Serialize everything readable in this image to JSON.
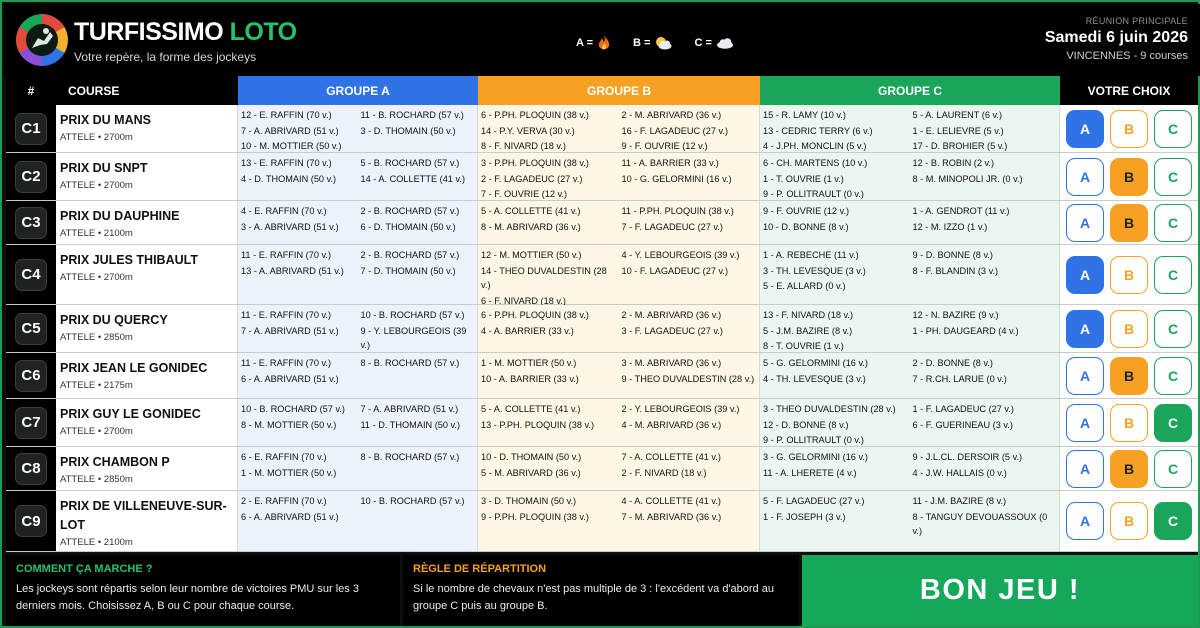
{
  "header": {
    "brand_main": "TURFISSIMO",
    "brand_accent": "LOTO",
    "tagline": "Votre repère, la forme des jockeys",
    "legend": [
      {
        "label": "A =",
        "icon": "flame-icon"
      },
      {
        "label": "B =",
        "icon": "sun-cloud-icon"
      },
      {
        "label": "C =",
        "icon": "cloud-icon"
      }
    ],
    "meeting_label": "RÉUNION PRINCIPALE",
    "meeting_date": "Samedi 6 juin 2026",
    "meeting_venue": "VINCENNES - 9 courses"
  },
  "columns": {
    "num": "#",
    "course": "COURSE",
    "group_a": "GROUPE A",
    "group_b": "GROUPE B",
    "group_c": "GROUPE C",
    "choice": "VOTRE CHOIX"
  },
  "races": [
    {
      "id": "C1",
      "name": "PRIX DU MANS",
      "info": "ATTELE • 2700m",
      "selected": "A",
      "a": [
        "12 - E. RAFFIN (70 v.)",
        "11 - B. ROCHARD (57 v.)",
        "7 - A. ABRIVARD (51 v.)",
        "3 - D. THOMAIN (50 v.)",
        "10 - M. MOTTIER (50 v.)"
      ],
      "b": [
        "6 - P.PH. PLOQUIN (38 v.)",
        "2 - M. ABRIVARD (36 v.)",
        "14 - P.Y. VERVA (30 v.)",
        "16 - F. LAGADEUC (27 v.)",
        "8 - F. NIVARD (18 v.)",
        "9 - F. OUVRIE (12 v.)"
      ],
      "c": [
        "15 - R. LAMY (10 v.)",
        "5 - A. LAURENT (6 v.)",
        "13 - CEDRIC TERRY (6 v.)",
        "1 - E. LELIEVRE (5 v.)",
        "4 - J.PH. MONCLIN (5 v.)",
        "17 - D. BROHIER (5 v.)"
      ]
    },
    {
      "id": "C2",
      "name": "PRIX DU SNPT",
      "info": "ATTELE • 2700m",
      "selected": "B",
      "a": [
        "13 - E. RAFFIN (70 v.)",
        "5 - B. ROCHARD (57 v.)",
        "4 - D. THOMAIN (50 v.)",
        "14 - A. COLLETTE (41 v.)"
      ],
      "b": [
        "3 - P.PH. PLOQUIN (38 v.)",
        "11 - A. BARRIER (33 v.)",
        "2 - F. LAGADEUC (27 v.)",
        "10 - G. GELORMINI (16 v.)",
        "7 - F. OUVRIE (12 v.)"
      ],
      "c": [
        "6 - CH. MARTENS (10 v.)",
        "12 - B. ROBIN (2 v.)",
        "1 - T. OUVRIE (1 v.)",
        "8 - M. MINOPOLI JR. (0 v.)",
        "9 - P. OLLITRAULT (0 v.)"
      ]
    },
    {
      "id": "C3",
      "name": "PRIX DU DAUPHINE",
      "info": "ATTELE • 2100m",
      "selected": "B",
      "a": [
        "4 - E. RAFFIN (70 v.)",
        "2 - B. ROCHARD (57 v.)",
        "3 - A. ABRIVARD (51 v.)",
        "6 - D. THOMAIN (50 v.)"
      ],
      "b": [
        "5 - A. COLLETTE (41 v.)",
        "11 - P.PH. PLOQUIN (38 v.)",
        "8 - M. ABRIVARD (36 v.)",
        "7 - F. LAGADEUC (27 v.)"
      ],
      "c": [
        "9 - F. OUVRIE (12 v.)",
        "1 - A. GENDROT (11 v.)",
        "10 - D. BONNE (8 v.)",
        "12 - M. IZZO (1 v.)"
      ]
    },
    {
      "id": "C4",
      "name": "PRIX JULES THIBAULT",
      "info": "ATTELE • 2700m",
      "selected": "A",
      "a": [
        "11 - E. RAFFIN (70 v.)",
        "2 - B. ROCHARD (57 v.)",
        "13 - A. ABRIVARD (51 v.)",
        "7 - D. THOMAIN (50 v.)"
      ],
      "b": [
        "12 - M. MOTTIER (50 v.)",
        "4 - Y. LEBOURGEOIS (39 v.)",
        "14 - THEO DUVALDESTIN (28 v.)",
        "10 - F. LAGADEUC (27 v.)",
        "6 - F. NIVARD (18 v.)",
        ""
      ],
      "c": [
        "1 - A. REBECHE (11 v.)",
        "9 - D. BONNE (8 v.)",
        "3 - TH. LEVESQUE (3 v.)",
        "8 - F. BLANDIN (3 v.)",
        "5 - E. ALLARD (0 v.)",
        ""
      ]
    },
    {
      "id": "C5",
      "name": "PRIX DU QUERCY",
      "info": "ATTELE • 2850m",
      "selected": "A",
      "a": [
        "11 - E. RAFFIN (70 v.)",
        "10 - B. ROCHARD (57 v.)",
        "7 - A. ABRIVARD (51 v.)",
        "9 - Y. LEBOURGEOIS (39 v.)"
      ],
      "b": [
        "6 - P.PH. PLOQUIN (38 v.)",
        "2 - M. ABRIVARD (36 v.)",
        "4 - A. BARRIER (33 v.)",
        "3 - F. LAGADEUC (27 v.)"
      ],
      "c": [
        "13 - F. NIVARD (18 v.)",
        "12 - N. BAZIRE (9 v.)",
        "5 - J.M. BAZIRE (8 v.)",
        "1 - PH. DAUGEARD (4 v.)",
        "8 - T. OUVRIE (1 v.)",
        ""
      ]
    },
    {
      "id": "C6",
      "name": "PRIX JEAN LE GONIDEC",
      "info": "ATTELE • 2175m",
      "selected": "B",
      "a": [
        "11 - E. RAFFIN (70 v.)",
        "8 - B. ROCHARD (57 v.)",
        "6 - A. ABRIVARD (51 v.)",
        ""
      ],
      "b": [
        "1 - M. MOTTIER (50 v.)",
        "3 - M. ABRIVARD (36 v.)",
        "10 - A. BARRIER (33 v.)",
        "9 - THEO DUVALDESTIN (28 v.)"
      ],
      "c": [
        "5 - G. GELORMINI (16 v.)",
        "2 - D. BONNE (8 v.)",
        "4 - TH. LEVESQUE (3 v.)",
        "7 - R.CH. LARUE (0 v.)"
      ]
    },
    {
      "id": "C7",
      "name": "PRIX GUY LE GONIDEC",
      "info": "ATTELE • 2700m",
      "selected": "C",
      "a": [
        "10 - B. ROCHARD (57 v.)",
        "7 - A. ABRIVARD (51 v.)",
        "8 - M. MOTTIER (50 v.)",
        "11 - D. THOMAIN (50 v.)"
      ],
      "b": [
        "5 - A. COLLETTE (41 v.)",
        "2 - Y. LEBOURGEOIS (39 v.)",
        "13 - P.PH. PLOQUIN (38 v.)",
        "4 - M. ABRIVARD (36 v.)"
      ],
      "c": [
        "3 - THEO DUVALDESTIN (28 v.)",
        "1 - F. LAGADEUC (27 v.)",
        "12 - D. BONNE (8 v.)",
        "6 - F. GUERINEAU (3 v.)",
        "9 - P. OLLITRAULT (0 v.)",
        ""
      ]
    },
    {
      "id": "C8",
      "name": "PRIX CHAMBON P",
      "info": "ATTELE • 2850m",
      "selected": "B",
      "a": [
        "6 - E. RAFFIN (70 v.)",
        "8 - B. ROCHARD (57 v.)",
        "1 - M. MOTTIER (50 v.)",
        ""
      ],
      "b": [
        "10 - D. THOMAIN (50 v.)",
        "7 - A. COLLETTE (41 v.)",
        "5 - M. ABRIVARD (36 v.)",
        "2 - F. NIVARD (18 v.)"
      ],
      "c": [
        "3 - G. GELORMINI (16 v.)",
        "9 - J.L.CL. DERSOIR (5 v.)",
        "11 - A. LHERETE (4 v.)",
        "4 - J.W. HALLAIS (0 v.)"
      ]
    },
    {
      "id": "C9",
      "name": "PRIX DE VILLENEUVE-SUR-LOT",
      "info": "ATTELE • 2100m",
      "selected": "C",
      "a": [
        "2 - E. RAFFIN (70 v.)",
        "10 - B. ROCHARD (57 v.)",
        "6 - A. ABRIVARD (51 v.)",
        ""
      ],
      "b": [
        "3 - D. THOMAIN (50 v.)",
        "4 - A. COLLETTE (41 v.)",
        "9 - P.PH. PLOQUIN (38 v.)",
        "7 - M. ABRIVARD (36 v.)"
      ],
      "c": [
        "5 - F. LAGADEUC (27 v.)",
        "11 - J.M. BAZIRE (8 v.)",
        "1 - F. JOSEPH (3 v.)",
        "8 - TANGUY DEVOUASSOUX (0 v.)"
      ]
    }
  ],
  "choices": [
    "A",
    "B",
    "C"
  ],
  "footer": {
    "how_title": "COMMENT ÇA MARCHE ?",
    "how_text": "Les jockeys sont répartis selon leur nombre de victoires PMU sur les 3 derniers mois. Choisissez A, B ou C pour chaque course.",
    "rule_title": "RÈGLE DE RÉPARTITION",
    "rule_text": "Si le nombre de chevaux n'est pas multiple de 3 : l'excédent va d'abord au groupe C puis au groupe B.",
    "bon_jeu": "BON JEU !"
  },
  "colors": {
    "group_a": "#2f73e6",
    "group_b": "#f6a123",
    "group_c": "#1aa55a",
    "brand_green": "#25c46a"
  }
}
